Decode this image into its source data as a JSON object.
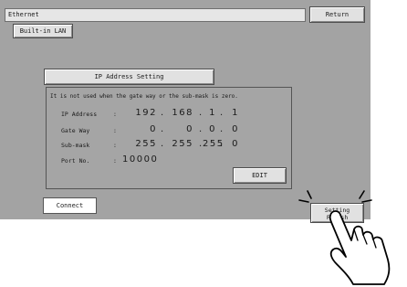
{
  "window": {
    "title": "Ethernet"
  },
  "header": {
    "return_label": "Return"
  },
  "tab": {
    "label": "Built-in LAN"
  },
  "section": {
    "title": "IP Address Setting"
  },
  "note": "It is not used when the gate way or the sub-mask is zero.",
  "fields": [
    {
      "label": "IP Address",
      "values": [
        "192",
        "168",
        "1",
        "1"
      ]
    },
    {
      "label": "Gate Way",
      "values": [
        "0",
        "0",
        "0",
        "0"
      ]
    },
    {
      "label": "Sub-mask",
      "values": [
        "255",
        "255",
        "255",
        "0"
      ]
    },
    {
      "label": "Port No.",
      "values": [
        "10000"
      ]
    }
  ],
  "buttons": {
    "edit": "EDIT",
    "connect": "Connect",
    "setting_finish_line1": "Setting",
    "setting_finish_line2": "Finish"
  },
  "icons": {
    "pointer": "pointing-hand-icon"
  }
}
